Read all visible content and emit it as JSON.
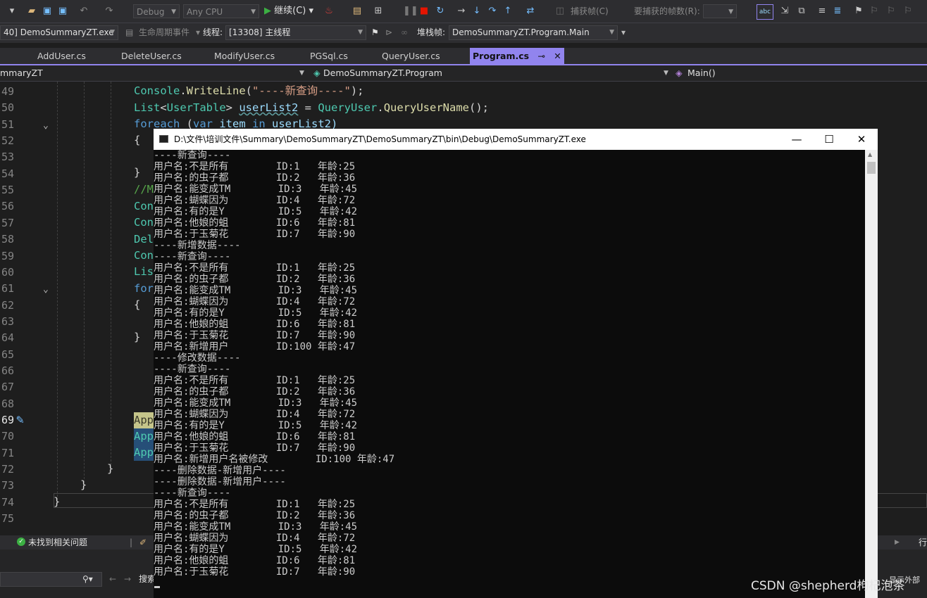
{
  "toolbar": {
    "config": "Debug",
    "platform": "Any CPU",
    "continue_label": "继续(C)",
    "capture_label": "捕获帧(C)",
    "frames_label": "要捕获的帧数(R):"
  },
  "debug_bar": {
    "process": "40] DemoSummaryZT.exe",
    "lifecycle": "生命周期事件",
    "thread_label": "线程:",
    "thread": "[13308] 主线程",
    "stack_label": "堆栈帧:",
    "stack_frame": "DemoSummaryZT.Program.Main"
  },
  "tabs": [
    {
      "label": "AddUser.cs"
    },
    {
      "label": "DeleteUser.cs"
    },
    {
      "label": "ModifyUser.cs"
    },
    {
      "label": "PGSql.cs"
    },
    {
      "label": "QueryUser.cs"
    },
    {
      "label": "Program.cs",
      "pin": "⊸",
      "close": "✕"
    }
  ],
  "nav": {
    "project": "mmaryZT",
    "class": "DemoSummaryZT.Program",
    "member": "Main()"
  },
  "editor": {
    "line_numbers": [
      "49",
      "50",
      "51",
      "52",
      "53",
      "54",
      "55",
      "56",
      "57",
      "58",
      "59",
      "60",
      "61",
      "62",
      "63",
      "64",
      "65",
      "66",
      "67",
      "68",
      "69",
      "70",
      "71",
      "72",
      "73",
      "74",
      "75"
    ],
    "current_line": "69",
    "code": {
      "l49": {
        "a": "Console",
        "b": ".",
        "c": "WriteLine",
        "d": "(",
        "e": "\"----新查询----\"",
        "f": ");"
      },
      "l50": {
        "a": "List",
        "b": "<",
        "c": "UserTable",
        "d": "> ",
        "e": "userList2",
        "f": " = ",
        "g": "QueryUser",
        "h": ".",
        "i": "QueryUserName",
        "j": "();"
      },
      "l51": {
        "a": "foreach",
        "b": " (",
        "c": "var",
        "d": " item ",
        "e": "in",
        "f": " userList2)"
      },
      "l52": "{",
      "l54": "}",
      "l55": "//M",
      "l56": "Con",
      "l57": "Con",
      "l58": "Del",
      "l59": "Con",
      "l60": "Lis",
      "l61": "for",
      "l62": "{",
      "l64": "}",
      "l69": "App",
      "l70": "App",
      "l71": "App",
      "l72": "}",
      "l73": "}",
      "l74": "}"
    }
  },
  "status": {
    "issues": "未找到相关问题",
    "right_label": "行"
  },
  "bottom": {
    "search_label": "搜索",
    "right_text": "显示外部"
  },
  "console": {
    "title": "D:\\文件\\培训文件\\Summary\\DemoSummaryZT\\DemoSummaryZT\\bin\\Debug\\DemoSummaryZT.exe",
    "minimize": "—",
    "maximize": "☐",
    "close": "✕",
    "lines": [
      "----新查询----",
      "用户名:不是所有        ID:1   年龄:25",
      "用户名:的虫子都        ID:2   年龄:36",
      "用户名:能变成TM        ID:3   年龄:45",
      "用户名:蝴蝶因为        ID:4   年龄:72",
      "用户名:有的是Y         ID:5   年龄:42",
      "用户名:他娘的蛆        ID:6   年龄:81",
      "用户名:于玉菊花        ID:7   年龄:90",
      "----新增数据----",
      "----新查询----",
      "用户名:不是所有        ID:1   年龄:25",
      "用户名:的虫子都        ID:2   年龄:36",
      "用户名:能变成TM        ID:3   年龄:45",
      "用户名:蝴蝶因为        ID:4   年龄:72",
      "用户名:有的是Y         ID:5   年龄:42",
      "用户名:他娘的蛆        ID:6   年龄:81",
      "用户名:于玉菊花        ID:7   年龄:90",
      "用户名:新增用户        ID:100 年龄:47",
      "----修改数据----",
      "----新查询----",
      "用户名:不是所有        ID:1   年龄:25",
      "用户名:的虫子都        ID:2   年龄:36",
      "用户名:能变成TM        ID:3   年龄:45",
      "用户名:蝴蝶因为        ID:4   年龄:72",
      "用户名:有的是Y         ID:5   年龄:42",
      "用户名:他娘的蛆        ID:6   年龄:81",
      "用户名:于玉菊花        ID:7   年龄:90",
      "用户名:新增用户名被修改        ID:100 年龄:47",
      "----删除数据-新增用户----",
      "----删除数据-新增用户----",
      "----新查询----",
      "用户名:不是所有        ID:1   年龄:25",
      "用户名:的虫子都        ID:2   年龄:36",
      "用户名:能变成TM        ID:3   年龄:45",
      "用户名:蝴蝶因为        ID:4   年龄:72",
      "用户名:有的是Y         ID:5   年龄:42",
      "用户名:他娘的蛆        ID:6   年龄:81",
      "用户名:于玉菊花        ID:7   年龄:90"
    ]
  },
  "watermark": "CSDN @shepherd枸杞泡茶",
  "colors": {
    "accent": "#9184ee",
    "editor_bg": "#1e1e1e",
    "console_bg": "#0c0c0c",
    "continue_green": "#3cb043",
    "stop_red": "#e51400"
  }
}
